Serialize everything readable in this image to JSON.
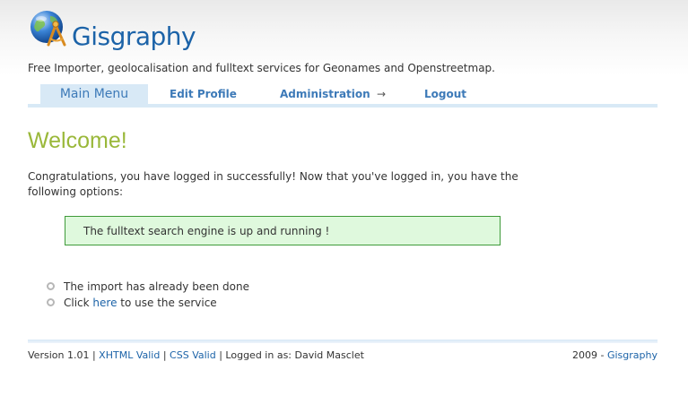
{
  "header": {
    "brand": "Gisgraphy",
    "logo_icon": "globe-compass-icon",
    "tagline": "Free Importer, geolocalisation and fulltext services for Geonames and Openstreetmap."
  },
  "nav": {
    "items": [
      {
        "label": "Main Menu",
        "active": true
      },
      {
        "label": "Edit Profile"
      },
      {
        "label": "Administration",
        "icon": "arrow-right-icon",
        "arrow": "→"
      },
      {
        "label": "Logout"
      }
    ]
  },
  "main": {
    "title": "Welcome!",
    "intro": "Congratulations, you have logged in successfully! Now that you've logged in, you have the following options:",
    "status": "The fulltext search engine is up and running !",
    "options": {
      "item1": "The import has already been done",
      "item2_prefix": "Click ",
      "item2_link": "here",
      "item2_suffix": " to use the service"
    }
  },
  "footer": {
    "version": "Version 1.01",
    "sep": "|",
    "xhtml": "XHTML Valid",
    "css": "CSS Valid",
    "logged_in": "Logged in as: David Masclet",
    "year": "2009 - ",
    "brand_link": "Gisgraphy"
  },
  "colors": {
    "brand": "#1c63a8",
    "title_green": "#9ab83a",
    "nav_bar": "#d8e9f6",
    "status_bg": "#dff9dd",
    "status_border": "#3f9a3a"
  }
}
